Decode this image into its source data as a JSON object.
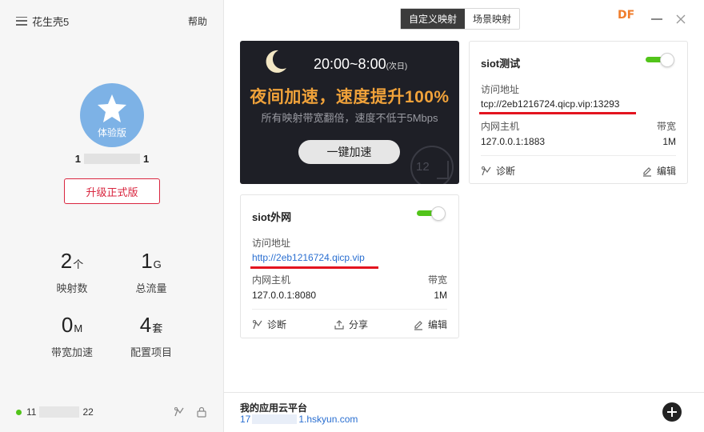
{
  "sidebar": {
    "app_name": "花生壳5",
    "help_label": "帮助",
    "avatar_badge": "体验版",
    "account_prefix": "1",
    "account_suffix": "1",
    "upgrade_label": "升级正式版",
    "stats": [
      {
        "value": "2",
        "unit": "个",
        "label": "映射数"
      },
      {
        "value": "1",
        "unit": "G",
        "label": "总流量"
      },
      {
        "value": "0",
        "unit": "M",
        "label": "带宽加速"
      },
      {
        "value": "4",
        "unit": "套",
        "label": "配置项目"
      }
    ],
    "footer": {
      "ip_prefix": "11",
      "ip_suffix": "22",
      "status_color": "#52c41a"
    }
  },
  "header": {
    "tabs": [
      {
        "label": "自定义映射",
        "active": true
      },
      {
        "label": "场景映射",
        "active": false
      }
    ],
    "logo_text": "DF"
  },
  "banner": {
    "time": "20:00~8:00",
    "time_note": "(次日)",
    "headline": "夜间加速，速度提升100%",
    "sub": "所有映射带宽翻倍，速度不低于5Mbps",
    "cta_label": "一键加速",
    "clock_number": "12"
  },
  "cards": {
    "siot_test": {
      "title": "siot测试",
      "enabled": true,
      "access_label": "访问地址",
      "access_url": "tcp://2eb1216724.qicp.vip:13293",
      "host_label": "内网主机",
      "host_value": "127.0.0.1:1883",
      "bandwidth_label": "带宽",
      "bandwidth_value": "1M",
      "diagnose_label": "诊断",
      "edit_label": "编辑"
    },
    "siot_ext": {
      "title": "siot外网",
      "enabled": true,
      "access_label": "访问地址",
      "access_url": "http://2eb1216724.qicp.vip",
      "host_label": "内网主机",
      "host_value": "127.0.0.1:8080",
      "bandwidth_label": "带宽",
      "bandwidth_value": "1M",
      "diagnose_label": "诊断",
      "share_label": "分享",
      "edit_label": "编辑"
    }
  },
  "bottom": {
    "title": "我的应用云平台",
    "link_prefix": "17",
    "link_suffix": "1.hskyun.com"
  },
  "colors": {
    "accent_red": "#d9263f",
    "link_blue": "#2a6fd1",
    "toggle_green": "#52c41a",
    "banner_gold": "#f0a23a",
    "logo_orange": "#f07d2c"
  }
}
